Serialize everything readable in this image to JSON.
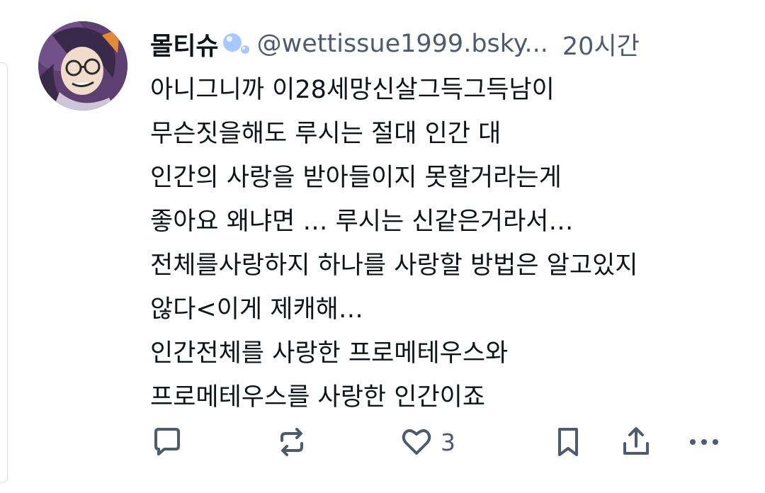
{
  "post": {
    "author_name": "몰티슈",
    "handle": "@wettissue1999.bsky...",
    "separator": "",
    "time_ago": "20시간",
    "badge_icon": "bubbles-icon",
    "lines": [
      "아니그니까 이28세망신살그득그득남이",
      "무슨짓을해도 루시는 절대 인간 대",
      "인간의 사랑을 받아들이지 못할거라는게",
      "좋아요 왜냐면 … 루시는 신같은거라서…",
      "전체를사랑하지 하나를 사랑할 방법은 알고있지",
      "않다<이게 제캐해…",
      "인간전체를 사랑한 프로메테우스와",
      "프로메테우스를 사랑한 인간이죠"
    ]
  },
  "actions": {
    "reply_icon": "reply-icon",
    "repost_icon": "repost-icon",
    "like_icon": "heart-icon",
    "like_count": "3",
    "bookmark_icon": "bookmark-icon",
    "share_icon": "share-icon",
    "more_icon": "more-icon"
  },
  "colors": {
    "text": "#0f141a",
    "muted": "#4d5b6c",
    "bubble": "#a9c8ff"
  }
}
